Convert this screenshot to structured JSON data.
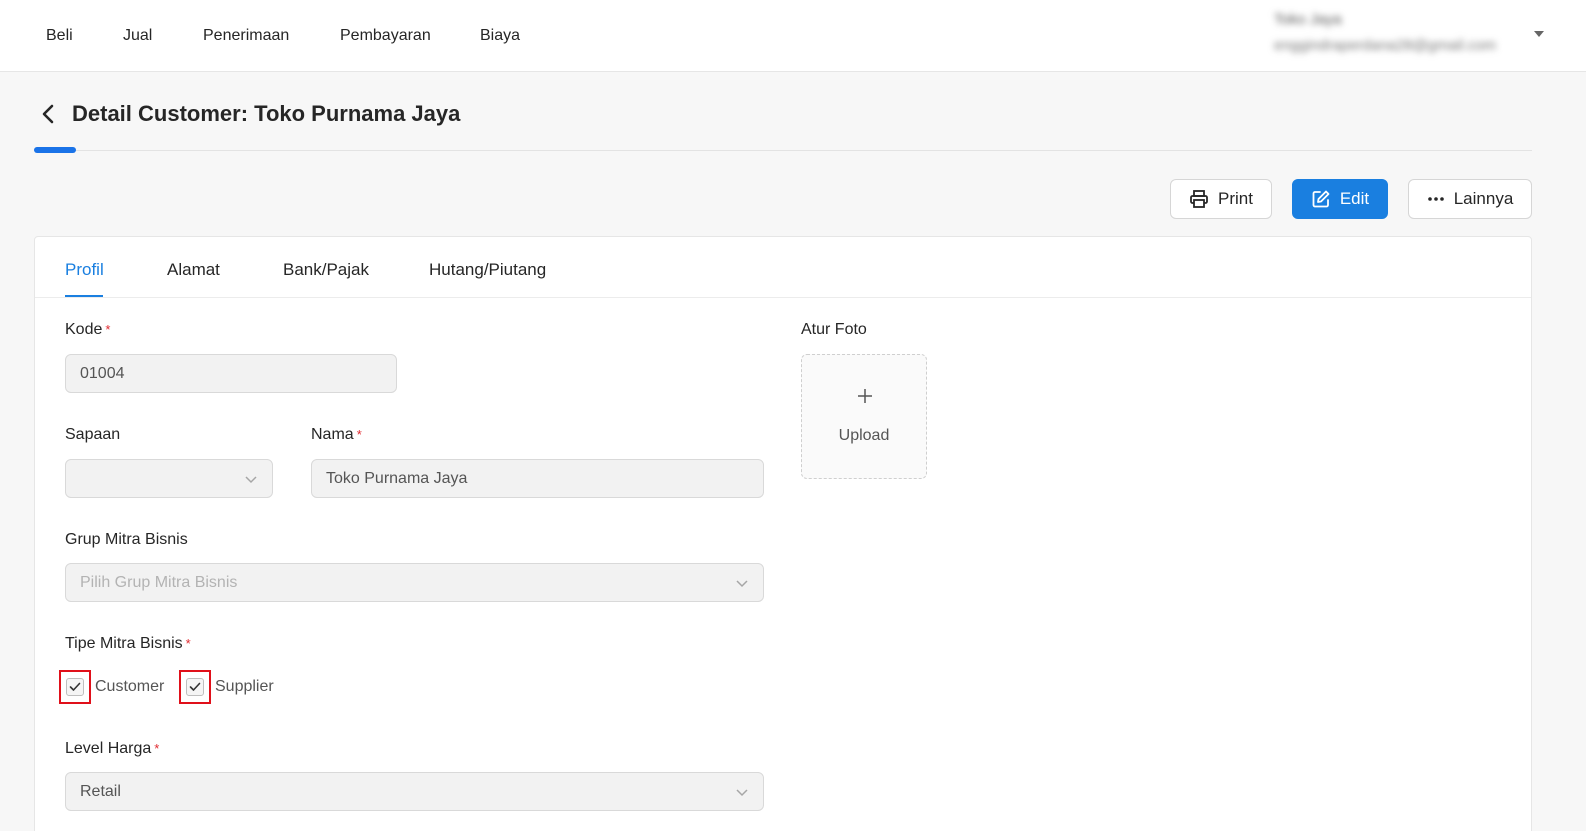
{
  "nav": {
    "items": [
      "Beli",
      "Jual",
      "Penerimaan",
      "Pembayaran",
      "Biaya"
    ],
    "user_name": "Toko Jaya",
    "user_email": "enggindraperdana28@gmail.com"
  },
  "header": {
    "title": "Detail Customer: Toko Purnama Jaya"
  },
  "actions": {
    "print": "Print",
    "edit": "Edit",
    "more": "Lainnya"
  },
  "tabs": [
    "Profil",
    "Alamat",
    "Bank/Pajak",
    "Hutang/Piutang"
  ],
  "active_tab": "Profil",
  "form": {
    "kode": {
      "label": "Kode",
      "value": "01004",
      "required": true
    },
    "sapaan": {
      "label": "Sapaan",
      "value": ""
    },
    "nama": {
      "label": "Nama",
      "value": "Toko Purnama Jaya",
      "required": true
    },
    "grup": {
      "label": "Grup Mitra Bisnis",
      "placeholder": "Pilih Grup Mitra Bisnis"
    },
    "tipe": {
      "label": "Tipe Mitra Bisnis",
      "required": true,
      "options": [
        {
          "label": "Customer",
          "checked": true
        },
        {
          "label": "Supplier",
          "checked": true
        }
      ]
    },
    "level_harga": {
      "label": "Level Harga",
      "value": "Retail",
      "required": true
    }
  },
  "photo": {
    "label": "Atur Foto",
    "upload_label": "Upload"
  },
  "colors": {
    "accent": "#1a7fe0",
    "required": "#e0282e",
    "highlight": "#e0101a"
  }
}
